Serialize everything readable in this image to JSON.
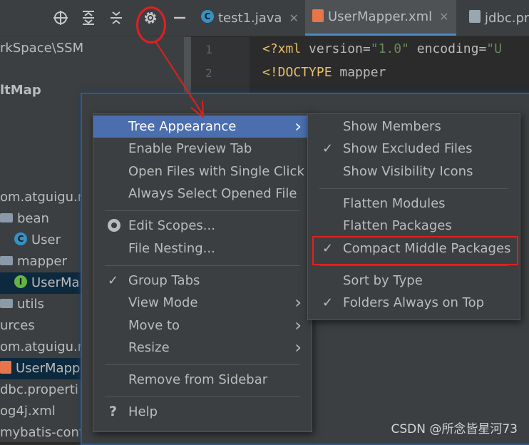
{
  "project": {
    "path_text": "rkSpace\\SSM",
    "tree": [
      {
        "label": "ltMap",
        "kind": "text",
        "bold": true
      },
      {
        "label": "om.atguigu.m",
        "kind": "text"
      },
      {
        "label": "bean",
        "kind": "folder"
      },
      {
        "label": "User",
        "kind": "class"
      },
      {
        "label": "mapper",
        "kind": "folder"
      },
      {
        "label": "UserMa",
        "kind": "interface"
      },
      {
        "label": "utils",
        "kind": "folder"
      },
      {
        "label": "urces",
        "kind": "text"
      },
      {
        "label": "om.atguigu.m",
        "kind": "text"
      },
      {
        "label": "UserMappe",
        "kind": "xml"
      },
      {
        "label": "dbc.properti",
        "kind": "text"
      },
      {
        "label": "og4j.xml",
        "kind": "text"
      },
      {
        "label": "mybatis-config.xml",
        "kind": "text"
      }
    ]
  },
  "toolbar": {
    "icons": [
      "crosshair-icon",
      "expand-all-icon",
      "collapse-all-icon",
      "gear-icon",
      "minimize-icon"
    ]
  },
  "tabs": [
    {
      "label": "test1.java",
      "icon": "class-icon",
      "active": false
    },
    {
      "label": "UserMapper.xml",
      "icon": "xml-icon",
      "active": true
    },
    {
      "label": "jdbc.pr",
      "icon": "properties-icon",
      "active": false
    }
  ],
  "editor": {
    "lines": [
      {
        "no": "1",
        "parts": [
          "<?xml ",
          "version=",
          "\"1.0\"",
          " encoding=",
          "\"U"
        ]
      },
      {
        "no": "2",
        "parts": [
          "<!DOCTYPE ",
          "mapper",
          "",
          "",
          ""
        ]
      }
    ]
  },
  "menu": {
    "items": [
      {
        "label": "Tree Appearance",
        "submenu": true,
        "highlighted": true
      },
      {
        "label": "Enable Preview Tab"
      },
      {
        "label": "Open Files with Single Click"
      },
      {
        "label": "Always Select Opened File"
      },
      {
        "label": "Edit Scopes...",
        "radio": true
      },
      {
        "label": "File Nesting..."
      },
      {
        "label": "Group Tabs",
        "checked": true
      },
      {
        "label": "View Mode",
        "submenu": true
      },
      {
        "label": "Move to",
        "submenu": true
      },
      {
        "label": "Resize",
        "submenu": true
      },
      {
        "label": "Remove from Sidebar"
      },
      {
        "label": "Help",
        "help": true
      }
    ]
  },
  "submenu": {
    "items": [
      {
        "label": "Show Members",
        "checked": false
      },
      {
        "label": "Show Excluded Files",
        "checked": true
      },
      {
        "label": "Show Visibility Icons",
        "checked": false
      },
      {
        "label": "Flatten Modules",
        "checked": false
      },
      {
        "label": "Flatten Packages",
        "checked": false
      },
      {
        "label": "Compact Middle Packages",
        "checked": true
      },
      {
        "label": "Sort by Type",
        "checked": false
      },
      {
        "label": "Folders Always on Top",
        "checked": true
      }
    ]
  },
  "watermark": "CSDN @所念皆星河73",
  "colors": {
    "highlight": "#4b6eaf",
    "annotation_red": "#e02020"
  }
}
